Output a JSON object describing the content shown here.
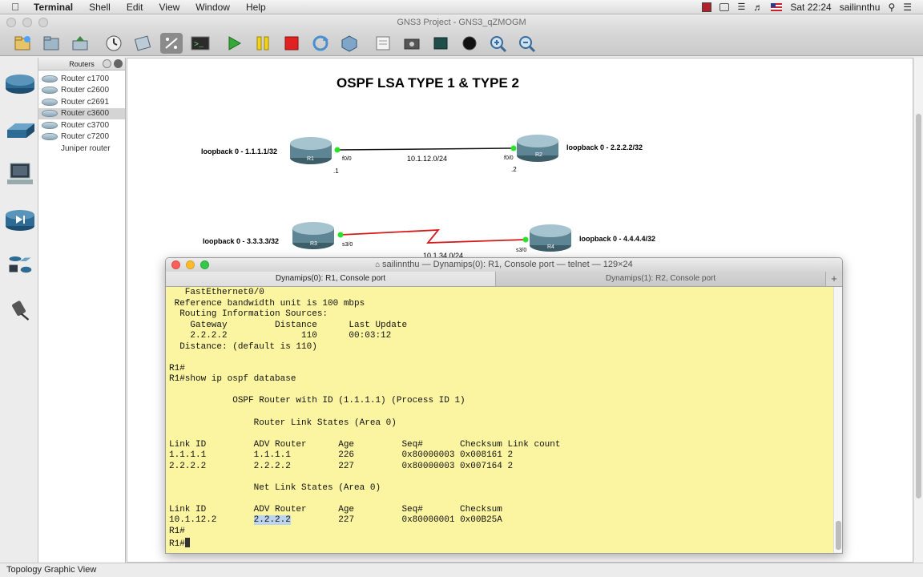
{
  "menubar": {
    "app": "Terminal",
    "items": [
      "Shell",
      "Edit",
      "View",
      "Window",
      "Help"
    ],
    "clock": "Sat 22:24",
    "user": "sailinnthu",
    "icons": [
      "apple-icon",
      "flag-icon",
      "airplay-icon",
      "wifi-icon",
      "volume-icon",
      "flag-us-icon",
      "search-icon",
      "list-icon"
    ]
  },
  "gns_window": {
    "title": "GNS3 Project - GNS3_qZMOGM"
  },
  "toolbar": {
    "icons": [
      "new-project-icon",
      "open-project-icon",
      "save-project-icon",
      "snapshot-icon",
      "link-icon",
      "capture-icon",
      "console-icon",
      "start-icon",
      "pause-icon",
      "stop-icon",
      "reload-icon",
      "virtualbox-icon",
      "note-icon",
      "screenshot-icon",
      "rectangle-icon",
      "ellipse-icon",
      "zoom-in-icon",
      "zoom-out-icon"
    ]
  },
  "routers_panel": {
    "title": "Routers",
    "items": [
      {
        "label": "Router c1700"
      },
      {
        "label": "Router c2600"
      },
      {
        "label": "Router c2691"
      },
      {
        "label": "Router c3600"
      },
      {
        "label": "Router c3700"
      },
      {
        "label": "Router c7200"
      },
      {
        "label": "Juniper router"
      }
    ],
    "selected_index": 3
  },
  "topology": {
    "title": "OSPF LSA TYPE 1 & TYPE 2",
    "r1": {
      "name": "R1",
      "loopback": "loopback 0 - 1.1.1.1/32",
      "port": "f0/0",
      "ip_suffix": ".1"
    },
    "r2": {
      "name": "R2",
      "loopback": "loopback 0 - 2.2.2.2/32",
      "port": "f0/0",
      "ip_suffix": ".2"
    },
    "r3": {
      "name": "R3",
      "loopback": "loopback 0 - 3.3.3.3/32",
      "port": "s3/0"
    },
    "r4": {
      "name": "R4",
      "loopback": "loopback 0 - 4.4.4.4/32",
      "port": "s3/0"
    },
    "link12": "10.1.12.0/24",
    "link34": "10.1.34.0/24"
  },
  "terminal": {
    "title": "sailinnthu — Dynamips(0): R1, Console port — telnet — 129×24",
    "tabs": [
      "Dynamips(0): R1, Console port",
      "Dynamips(1): R2, Console port"
    ],
    "lines": [
      "   FastEthernet0/0",
      " Reference bandwidth unit is 100 mbps",
      "  Routing Information Sources:",
      "    Gateway         Distance      Last Update",
      "    2.2.2.2              110      00:03:12",
      "  Distance: (default is 110)",
      "",
      "R1#",
      "R1#show ip ospf database",
      "",
      "            OSPF Router with ID (1.1.1.1) (Process ID 1)",
      "",
      "                Router Link States (Area 0)",
      "",
      "Link ID         ADV Router      Age         Seq#       Checksum Link count",
      "1.1.1.1         1.1.1.1         226         0x80000003 0x008161 2",
      "2.2.2.2         2.2.2.2         227         0x80000003 0x007164 2",
      "",
      "                Net Link States (Area 0)",
      "",
      "Link ID         ADV Router      Age         Seq#       Checksum",
      "10.1.12.2       ",
      "R1#",
      "R1#"
    ],
    "highlight": "2.2.2.2",
    "after_highlight": "         227         0x80000001 0x00B25A"
  },
  "statusbar": {
    "text": "Topology Graphic View"
  }
}
